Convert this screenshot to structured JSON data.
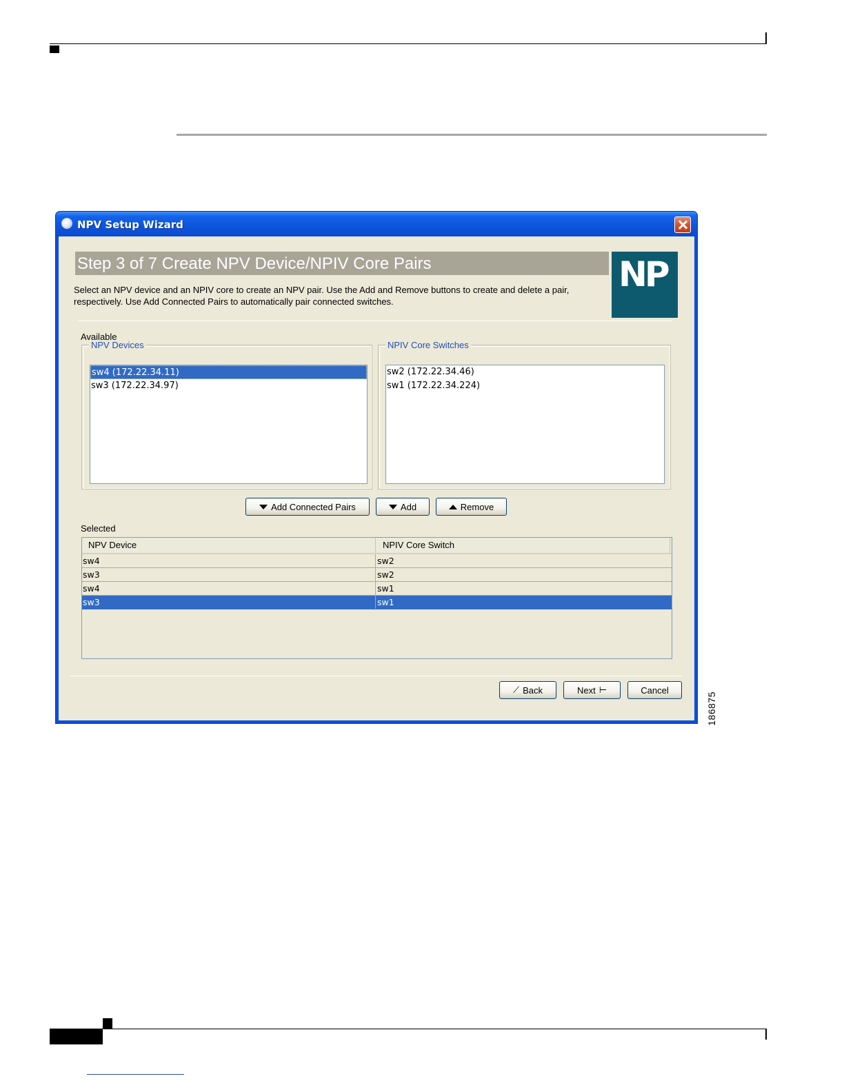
{
  "window": {
    "title": "NPV Setup Wizard"
  },
  "step": {
    "title": "Step 3 of 7 Create NPV Device/NPIV Core Pairs",
    "instructions": "Select an NPV device and an NPIV core to create an NPV pair.  Use the Add and Remove buttons to create and delete a pair, respectively.  Use Add Connected Pairs to automatically pair connected switches."
  },
  "logo": {
    "text": "NP",
    "color": "#0d5a6e"
  },
  "available": {
    "label": "Available",
    "npv_devices": {
      "legend": "NPV Devices",
      "items": [
        {
          "label": "sw4 (172.22.34.11)",
          "selected": true
        },
        {
          "label": "sw3 (172.22.34.97)",
          "selected": false
        }
      ]
    },
    "npiv_core_switches": {
      "legend": "NPIV Core Switches",
      "items": [
        {
          "label": "sw2 (172.22.34.46)",
          "selected": false
        },
        {
          "label": "sw1 (172.22.34.224)",
          "selected": false
        }
      ]
    }
  },
  "actions": {
    "add_connected_pairs": "Add Connected Pairs",
    "add": "Add",
    "remove": "Remove"
  },
  "selected": {
    "label": "Selected",
    "columns": [
      "NPV Device",
      "NPIV Core Switch"
    ],
    "rows": [
      {
        "npv_device": "sw4",
        "npiv_core_switch": "sw2",
        "selected": false
      },
      {
        "npv_device": "sw3",
        "npiv_core_switch": "sw2",
        "selected": false
      },
      {
        "npv_device": "sw4",
        "npiv_core_switch": "sw1",
        "selected": false
      },
      {
        "npv_device": "sw3",
        "npiv_core_switch": "sw1",
        "selected": true
      }
    ]
  },
  "navigation": {
    "back": "Back",
    "next": "Next",
    "cancel": "Cancel"
  },
  "figure_id": "186875",
  "colors": {
    "selection": "#316ac5",
    "titlebar": "#0d55dc",
    "dialog_background": "#ece9d8",
    "legend_text": "#1f4fb7"
  }
}
